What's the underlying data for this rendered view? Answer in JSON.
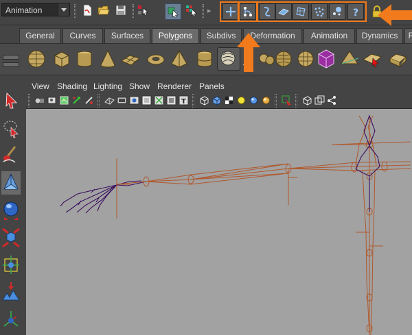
{
  "status_line": {
    "mode_menu": {
      "value": "Animation"
    },
    "highlight_color": "#f07a1c",
    "icons": [
      "new-scene-icon",
      "open-scene-icon",
      "save-scene-icon",
      "select-by-hierarchy-icon",
      "select-by-object-icon",
      "select-by-component-icon",
      "snap-to-grids-icon",
      "snap-to-curves-icon",
      "snap-to-points-icon",
      "snap-to-view-planes-icon",
      "make-live-icon",
      "history-icon",
      "render-icon",
      "ipr-render-icon",
      "render-settings-icon",
      "help-icon",
      "lock-icon"
    ]
  },
  "shelf": {
    "tabs": [
      {
        "label": "General"
      },
      {
        "label": "Curves"
      },
      {
        "label": "Surfaces"
      },
      {
        "label": "Polygons",
        "active": true
      },
      {
        "label": "Subdivs"
      },
      {
        "label": "Deformation"
      },
      {
        "label": "Animation"
      },
      {
        "label": "Dynamics"
      },
      {
        "label": "R"
      }
    ],
    "icons": [
      "poly-sphere-icon",
      "poly-cube-icon",
      "poly-cylinder-icon",
      "poly-cone-icon",
      "poly-plane-icon",
      "poly-torus-icon",
      "poly-pyramid-icon",
      "poly-pipe-icon",
      "poly-helix-icon",
      "combine-icon",
      "separate-icon",
      "smooth-icon",
      "texture-editor-icon",
      "extrude-icon",
      "split-polygon-icon",
      "bevel-icon"
    ]
  },
  "toolbox": {
    "tools": [
      "select-tool-icon",
      "lasso-tool-icon",
      "paint-select-tool-icon",
      "move-tool-icon",
      "rotate-tool-icon",
      "scale-tool-icon",
      "universal-manipulator-icon",
      "soft-modification-icon",
      "show-manipulator-icon"
    ]
  },
  "panel": {
    "menu": [
      {
        "label": "View"
      },
      {
        "label": "Shading"
      },
      {
        "label": "Lighting"
      },
      {
        "label": "Show"
      },
      {
        "label": "Renderer"
      },
      {
        "label": "Panels"
      }
    ],
    "toolbar_icons": [
      "camera-attributes-icon",
      "bookmark-icon",
      "image-plane-icon",
      "two-d-pan-icon",
      "grease-pencil-icon",
      "grid-icon",
      "film-gate-icon",
      "resolution-gate-icon",
      "gate-mask-icon",
      "field-chart-icon",
      "safe-action-icon",
      "safe-title-icon",
      "wireframe-icon",
      "smooth-shade-icon",
      "textured-icon",
      "lights-icon",
      "shadows-icon",
      "isolate-select-icon",
      "xray-icon",
      "xray-joints-icon"
    ]
  },
  "viewport": {
    "background": "#a2a2a2",
    "joint_color": "#c1612f",
    "influence_color": "#3a1060"
  }
}
